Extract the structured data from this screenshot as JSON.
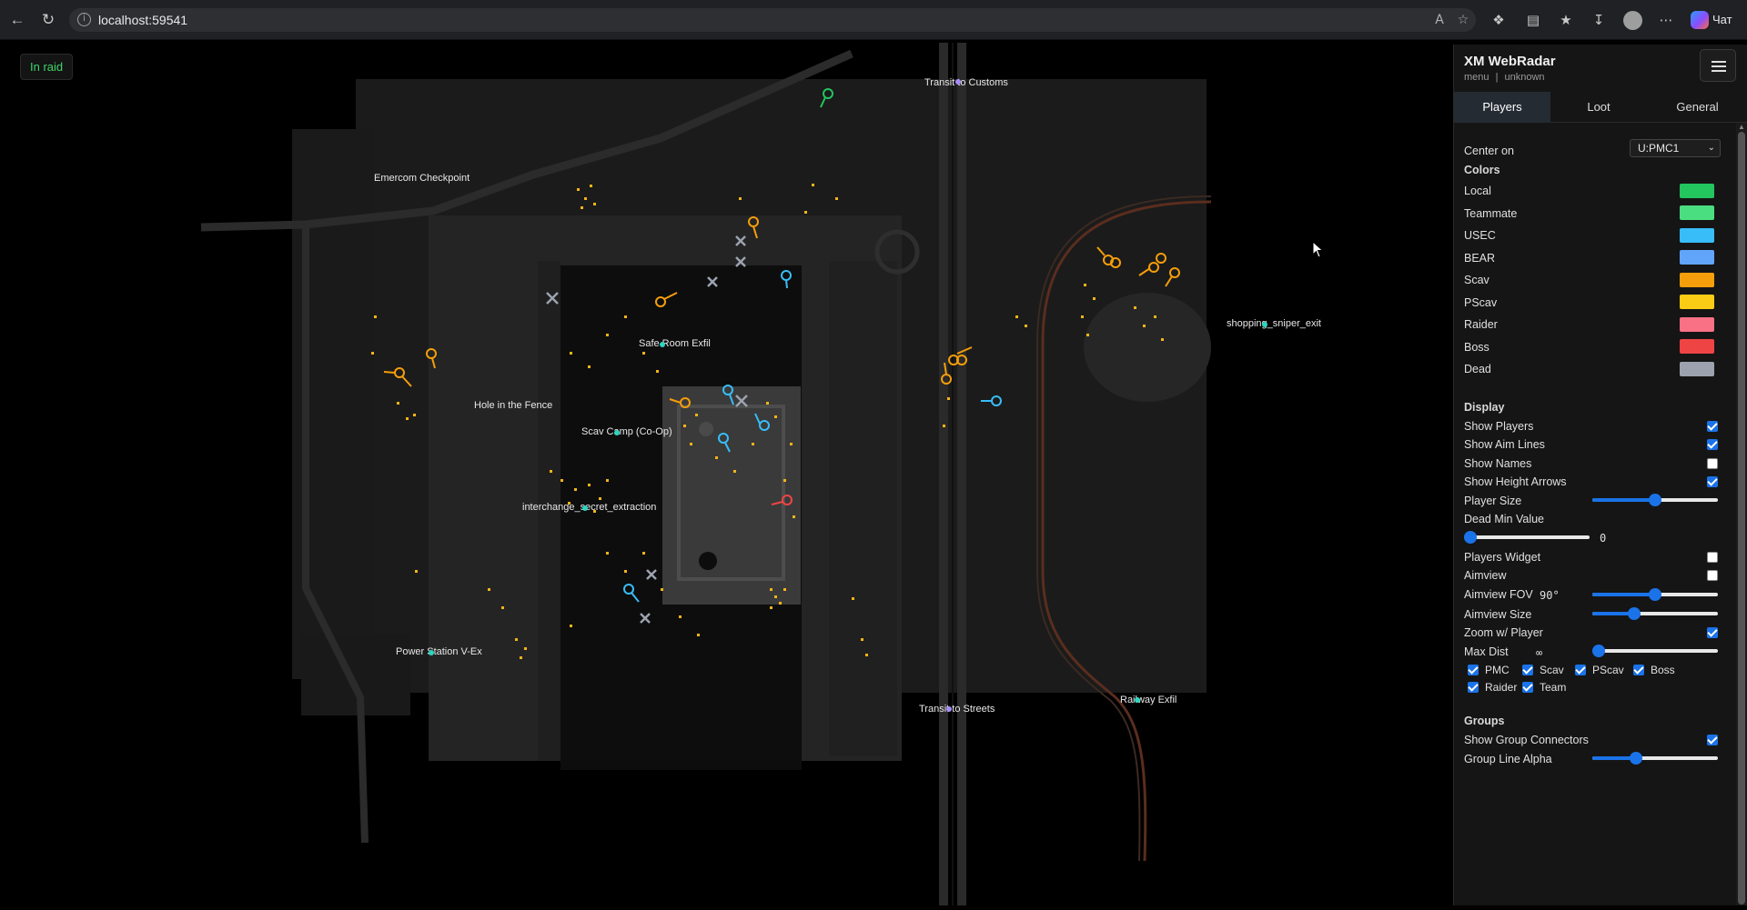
{
  "browser": {
    "url": "localhost:59541",
    "copilot_label": "Чат"
  },
  "map": {
    "status": "In raid",
    "labels": [
      {
        "text": "Transit to Customs"
      },
      {
        "text": "Emercom Checkpoint"
      },
      {
        "text": "Safe Room Exfil"
      },
      {
        "text": "shopping_sniper_exit"
      },
      {
        "text": "Hole in the Fence"
      },
      {
        "text": "Scav Camp (Co-Op)"
      },
      {
        "text": "interchange_secret_extraction"
      },
      {
        "text": "Power Station V-Ex"
      },
      {
        "text": "Transit to Streets"
      },
      {
        "text": "Railway Exfil"
      }
    ]
  },
  "sidebar": {
    "title": "XM WebRadar",
    "subtitle_left": "menu",
    "subtitle_sep": "|",
    "subtitle_right": "unknown",
    "tabs": [
      {
        "label": "Players"
      },
      {
        "label": "Loot"
      },
      {
        "label": "General"
      }
    ],
    "center_on_label": "Center on",
    "center_on_value": "U:PMC1",
    "colors_label": "Colors",
    "colors": [
      {
        "label": "Local",
        "color": "#22c55e"
      },
      {
        "label": "Teammate",
        "color": "#4ade80"
      },
      {
        "label": "USEC",
        "color": "#38bdf8"
      },
      {
        "label": "BEAR",
        "color": "#60a5fa"
      },
      {
        "label": "Scav",
        "color": "#f59e0b"
      },
      {
        "label": "PScav",
        "color": "#facc15"
      },
      {
        "label": "Raider",
        "color": "#f87185"
      },
      {
        "label": "Boss",
        "color": "#ef4444"
      },
      {
        "label": "Dead",
        "color": "#9ca3af"
      }
    ],
    "display_label": "Display",
    "toggles": [
      {
        "label": "Show Players",
        "checked": true
      },
      {
        "label": "Show Aim Lines",
        "checked": true
      },
      {
        "label": "Show Names",
        "checked": false
      },
      {
        "label": "Show Height Arrows",
        "checked": true
      }
    ],
    "player_size_label": "Player Size",
    "player_size_value": 0.5,
    "dead_min_value_label": "Dead Min Value",
    "dead_min_value": "0",
    "dead_min_fraction": 0,
    "players_widget_label": "Players Widget",
    "players_widget_checked": false,
    "aimview_label": "Aimview",
    "aimview_checked": false,
    "aimview_fov_label": "Aimview FOV",
    "aimview_fov_value": "90°",
    "aimview_fov_fraction": 0.5,
    "aimview_size_label": "Aimview Size",
    "aimview_size_fraction": 0.33,
    "zoom_label": "Zoom w/ Player",
    "zoom_checked": true,
    "max_dist_label": "Max Dist",
    "max_dist_value": "∞",
    "max_dist_fraction": 0,
    "filters": [
      {
        "label": "PMC"
      },
      {
        "label": "Scav"
      },
      {
        "label": "PScav"
      },
      {
        "label": "Boss"
      },
      {
        "label": "Raider"
      },
      {
        "label": "Team"
      }
    ],
    "groups_label": "Groups",
    "group_connectors_label": "Show Group Connectors",
    "group_connectors_checked": true,
    "group_alpha_label": "Group Line Alpha",
    "group_alpha_fraction": 0.35
  }
}
